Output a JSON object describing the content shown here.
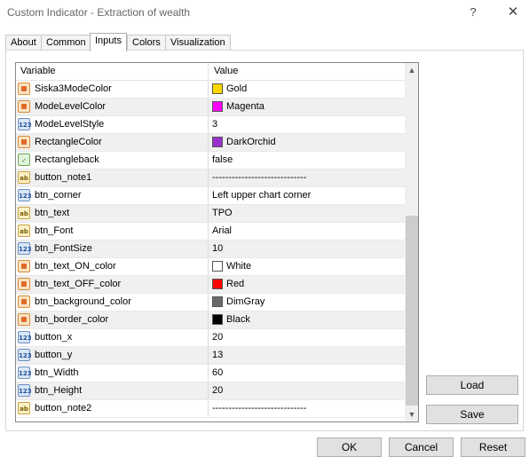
{
  "window": {
    "title": "Custom Indicator - Extraction of wealth",
    "help_icon": "?",
    "close_icon": "✕"
  },
  "tabs": [
    {
      "label": "About",
      "active": false
    },
    {
      "label": "Common",
      "active": false
    },
    {
      "label": "Inputs",
      "active": true
    },
    {
      "label": "Colors",
      "active": false
    },
    {
      "label": "Visualization",
      "active": false
    }
  ],
  "grid": {
    "headers": {
      "variable": "Variable",
      "value": "Value"
    },
    "rows": [
      {
        "variable": "Siska3ModeColor",
        "type": "color",
        "value": "Gold",
        "swatch": "#FFD700"
      },
      {
        "variable": "ModeLevelColor",
        "type": "color",
        "value": "Magenta",
        "swatch": "#FF00FF"
      },
      {
        "variable": "ModeLevelStyle",
        "type": "num",
        "value": "3"
      },
      {
        "variable": "RectangleColor",
        "type": "color",
        "value": "DarkOrchid",
        "swatch": "#9932CC"
      },
      {
        "variable": "Rectangleback",
        "type": "bool",
        "value": "false"
      },
      {
        "variable": "button_note1",
        "type": "str",
        "value": "-----------------------------"
      },
      {
        "variable": "btn_corner",
        "type": "num",
        "value": "Left upper chart corner"
      },
      {
        "variable": "btn_text",
        "type": "str",
        "value": "TPO"
      },
      {
        "variable": "btn_Font",
        "type": "str",
        "value": "Arial"
      },
      {
        "variable": "btn_FontSize",
        "type": "num",
        "value": "10"
      },
      {
        "variable": "btn_text_ON_color",
        "type": "color",
        "value": "White",
        "swatch": "#FFFFFF"
      },
      {
        "variable": "btn_text_OFF_color",
        "type": "color",
        "value": "Red",
        "swatch": "#FF0000"
      },
      {
        "variable": "btn_background_color",
        "type": "color",
        "value": "DimGray",
        "swatch": "#696969"
      },
      {
        "variable": "btn_border_color",
        "type": "color",
        "value": "Black",
        "swatch": "#000000"
      },
      {
        "variable": "button_x",
        "type": "num",
        "value": "20"
      },
      {
        "variable": "button_y",
        "type": "num",
        "value": "13"
      },
      {
        "variable": "btn_Width",
        "type": "num",
        "value": "60"
      },
      {
        "variable": "btn_Height",
        "type": "num",
        "value": "20"
      },
      {
        "variable": "button_note2",
        "type": "str",
        "value": "-----------------------------"
      }
    ],
    "scroll_up_icon": "▲",
    "scroll_down_icon": "▼"
  },
  "buttons": {
    "load": "Load",
    "save": "Save",
    "ok": "OK",
    "cancel": "Cancel",
    "reset": "Reset"
  },
  "icons": {
    "color": "color-type-icon",
    "num": "numeric-type-icon",
    "str": "string-type-icon",
    "bool": "boolean-type-icon"
  }
}
